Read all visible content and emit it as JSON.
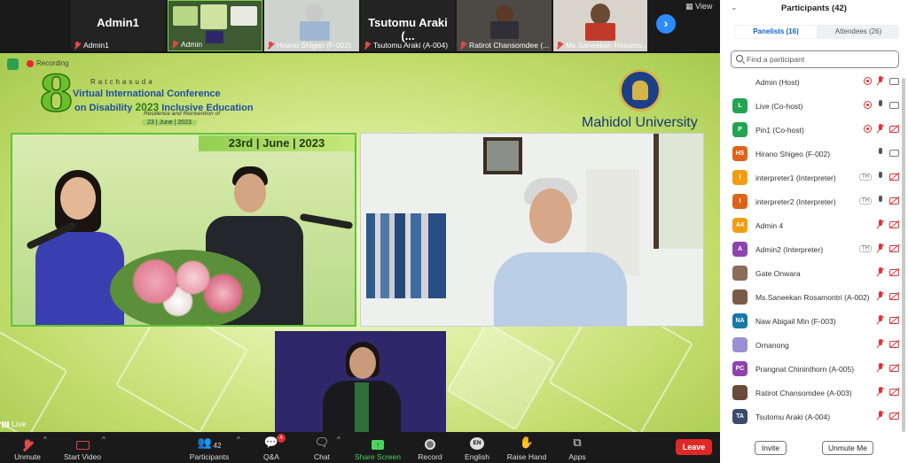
{
  "strip": {
    "tiles": [
      {
        "name": "Admin1",
        "label": "Admin1"
      },
      {
        "name": "",
        "label": "Admin"
      },
      {
        "name": "",
        "label": "Hirano Shigeo (F-002)"
      },
      {
        "name": "Tsutomu Araki (...",
        "label": "Tsutomu Araki (A-004)"
      },
      {
        "name": "",
        "label": "Ratirot Chansomdee (..."
      },
      {
        "name": "",
        "label": "Ms.Saneekan Rosamo..."
      }
    ],
    "next_icon": "›",
    "view_label": "View"
  },
  "stage": {
    "recording_label": "Recording",
    "conference": {
      "eight": "8",
      "top": "Ratchasuda",
      "title": "Virtual International Conference",
      "sub_prefix": "on Disability",
      "sub_year": "2023",
      "sub_suffix": "Inclusive Education",
      "tagline": "Resilience and Reinvention of",
      "date": "23 | June | 2023"
    },
    "university": "Mahidol University",
    "panel_a_date": "23rd | June | 2023",
    "live_label": "Live"
  },
  "toolbar": {
    "unmute": "Unmute",
    "start_video": "Start Video",
    "participants": "Participants",
    "participants_count": "42",
    "qa": "Q&A",
    "qa_badge": "4",
    "chat": "Chat",
    "share": "Share Screen",
    "record": "Record",
    "english": "English",
    "english_icon": "EN",
    "raise_hand": "Raise Hand",
    "apps": "Apps",
    "leave": "Leave"
  },
  "participants_panel": {
    "title": "Participants (42)",
    "tabs": [
      {
        "label": "Panelists (16)",
        "active": true
      },
      {
        "label": "Attendees (26)",
        "active": false
      }
    ],
    "search_placeholder": "Find a participant",
    "rows": [
      {
        "initials": "",
        "color": "#ffffff",
        "name": "Admin (Host)",
        "icons": [
          "rec",
          "mic-off",
          "cam"
        ]
      },
      {
        "initials": "L",
        "color": "#23a455",
        "name": "Live (Co-host)",
        "icons": [
          "rec",
          "mic",
          "cam"
        ]
      },
      {
        "initials": "P",
        "color": "#23a455",
        "name": "Pin1 (Co-host)",
        "icons": [
          "rec",
          "mic-off",
          "cam-off"
        ]
      },
      {
        "initials": "HS",
        "color": "#e0621a",
        "name": "Hirano Shigeo (F-002)",
        "icons": [
          "mic",
          "cam"
        ]
      },
      {
        "initials": "I",
        "color": "#f39c12",
        "name": "interpreter1 (Interpreter)",
        "icons": [
          "th",
          "mic",
          "cam-off"
        ]
      },
      {
        "initials": "I",
        "color": "#e0621a",
        "name": "interpreter2 (Interpreter)",
        "icons": [
          "th",
          "mic",
          "cam-off"
        ]
      },
      {
        "initials": "A4",
        "color": "#f39c12",
        "name": "Admin 4",
        "icons": [
          "mic-off",
          "cam-off"
        ]
      },
      {
        "initials": "A",
        "color": "#8e44ad",
        "name": "Admin2 (Interpreter)",
        "icons": [
          "th",
          "mic-off",
          "cam-off"
        ]
      },
      {
        "initials": "",
        "color": "#8a6d5a",
        "name": "Gate Onwara",
        "icons": [
          "mic-off",
          "cam-off"
        ]
      },
      {
        "initials": "",
        "color": "#7a5b4a",
        "name": "Ms.Saneekan Rosamontri (A-002)",
        "icons": [
          "mic-off",
          "cam-off"
        ]
      },
      {
        "initials": "NA",
        "color": "#1677a8",
        "name": "Naw Abigail Min (F-003)",
        "icons": [
          "mic-off",
          "cam-off"
        ]
      },
      {
        "initials": "",
        "color": "#9b8fd6",
        "name": "Ornanong",
        "icons": [
          "mic-off",
          "cam-off"
        ]
      },
      {
        "initials": "PC",
        "color": "#8e44ad",
        "name": "Prangnat Chininthorn (A-005)",
        "icons": [
          "mic-off",
          "cam-off"
        ]
      },
      {
        "initials": "",
        "color": "#6a4a3a",
        "name": "Ratirot Chansomdee (A-003)",
        "icons": [
          "mic-off",
          "cam-off"
        ]
      },
      {
        "initials": "TA",
        "color": "#3a4a6a",
        "name": "Tsutomu Araki (A-004)",
        "icons": [
          "mic-off",
          "cam-off"
        ]
      }
    ],
    "invite": "Invite",
    "unmute_me": "Unmute Me"
  }
}
